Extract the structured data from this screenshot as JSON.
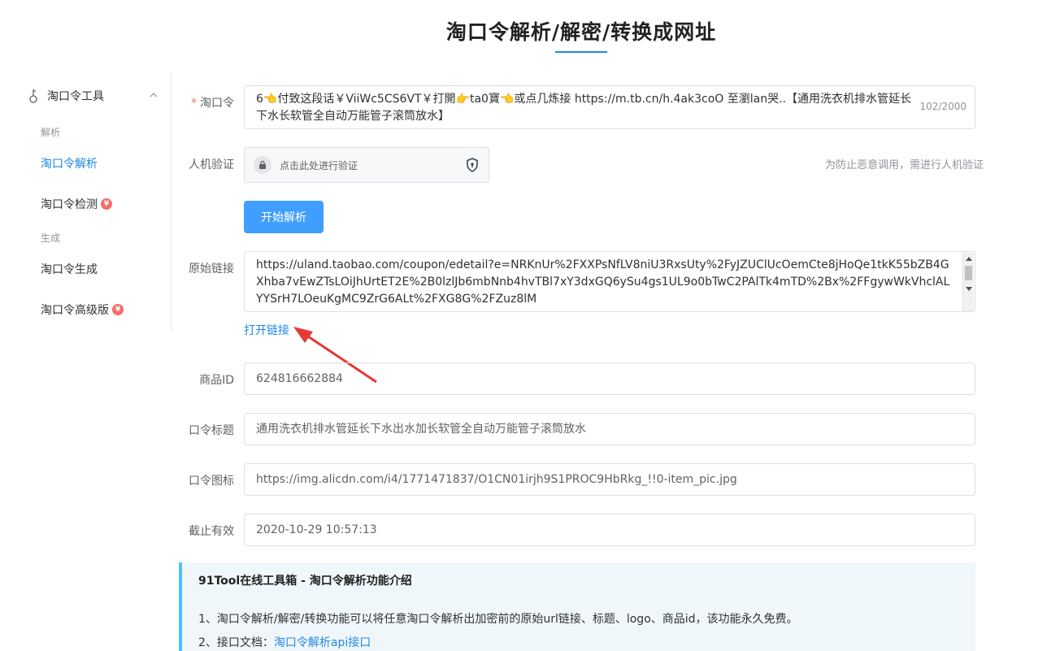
{
  "page_title": "淘口令解析/解密/转换成网址",
  "sidebar": {
    "group_label": "淘口令工具",
    "section_parse": "解析",
    "item_parse": "淘口令解析",
    "item_check": "淘口令检测",
    "section_generate": "生成",
    "item_generate": "淘口令生成",
    "item_advanced": "淘口令高级版",
    "badge": "¥"
  },
  "form": {
    "code_label": "淘口令",
    "code_value": "6👈付致这段话￥ViiWc5CS6VT￥打開👉ta0寶👈或点几炼接 https://m.tb.cn/h.4ak3coO 至瀏lan哭..【通用洗衣机排水管延长下水长软管全自动万能管子滚筒放水】",
    "code_counter": "102/2000",
    "captcha_label": "人机验证",
    "captcha_text": "点击此处进行验证",
    "captcha_note": "为防止恶意调用，需进行人机验证",
    "submit_label": "开始解析",
    "origin_label": "原始链接",
    "origin_value": "https://uland.taobao.com/coupon/edetail?e=NRKnUr%2FXXPsNfLV8niU3RxsUty%2FyJZUClUcOemCte8jHoQe1tkK55bZB4GXhba7vEwZTsLOiJhUrtET2E%2B0lzlJb6mbNnb4hvTBl7xY3dxGQ6ySu4gs1UL9o0bTwC2PAlTk4mTD%2Bx%2FFgywWkVhclALYYSrH7LOeuKgMC9ZrG6ALt%2FXG8G%2FZuz8lM",
    "open_link": "打开链接",
    "item_id_label": "商品ID",
    "item_id_value": "624816662884",
    "title_label": "口令标题",
    "title_value": "通用洗衣机排水管延长下水出水加长软管全自动万能管子滚筒放水",
    "icon_label": "口令图标",
    "icon_value": "https://img.alicdn.com/i4/1771471837/O1CN01irjh9S1PROC9HbRkg_!!0-item_pic.jpg",
    "expire_label": "截止有效",
    "expire_value": "2020-10-29 10:57:13"
  },
  "info": {
    "title": "91Tool在线工具箱 - 淘口令解析功能介绍",
    "line1": "1、淘口令解析/解密/转换功能可以将任意淘口令解析出加密前的原始url链接、标题、logo、商品id，该功能永久免费。",
    "line2_prefix": "2、接口文档：",
    "line2_link": "淘口令解析api接口"
  },
  "colors": {
    "accent": "#1e88e5",
    "button": "#409eff",
    "badge": "#f56c6c",
    "arrow": "#e53935"
  }
}
